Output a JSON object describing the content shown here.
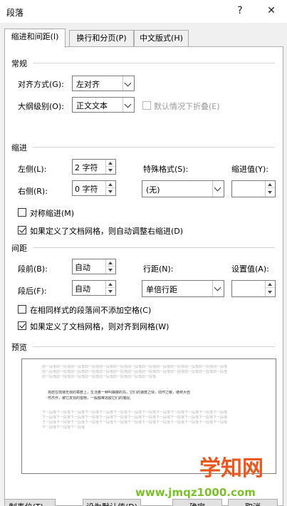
{
  "window": {
    "title": "段落",
    "help_icon": "?",
    "close_icon": "✕"
  },
  "tabs": [
    "缩进和间距(I)",
    "换行和分页(P)",
    "中文版式(H)"
  ],
  "general": {
    "heading": "常规",
    "alignment_label": "对齐方式(G):",
    "alignment_value": "左对齐",
    "outline_label": "大纲级别(O):",
    "outline_value": "正文文本",
    "collapsed_label": "默认情况下折叠(E)"
  },
  "indent": {
    "heading": "缩进",
    "left_label": "左侧(L):",
    "left_value": "2 字符",
    "right_label": "右侧(R):",
    "right_value": "0 字符",
    "special_label": "特殊格式(S):",
    "special_value": "(无)",
    "by_label": "缩进值(Y):",
    "by_value": "",
    "mirror_label": "对称缩进(M)",
    "mirror_checked": false,
    "auto_adjust_label": "如果定义了文档网格，则自动调整右缩进(D)",
    "auto_adjust_checked": true
  },
  "spacing": {
    "heading": "间距",
    "before_label": "段前(B):",
    "before_value": "自动",
    "after_label": "段后(F):",
    "after_value": "自动",
    "line_label": "行距(N):",
    "line_value": "单倍行距",
    "at_label": "设置值(A):",
    "at_value": "",
    "no_space_label": "在相同样式的段落间不添加空格(C)",
    "no_space_checked": false,
    "snap_label": "如果定义了文档网格，则对齐到网格(W)",
    "snap_checked": true
  },
  "preview": {
    "heading": "预览",
    "prev_lines": [
      "前一段落前一段落前一段落前一段落前一段落前一段落前一段落前一段落前一段落前一段落前一段落前一段落前一段落",
      "前一段落前一段落前一段落前一段落前一段落前一段落前一段落前一段落前一段落前一段落前一段落前一段落前一段落",
      "前一段落前一段落前一段落前一段落前一段落前一段落前一段落前一段落"
    ],
    "sample_lines": [
      "将居在琉璃无垠的章群上，生活着一种叫蝴蝶的鸟，它们的速度之快，动作之敏，堪称大自",
      "然杰作，被它发现的猎物，一般都难逃脱它们的捕捉。"
    ],
    "next_lines": [
      "下一段落下一段落下一段落下一段落下一段落下一段落下一段落下一段落下一段落下一段落下一段落下一段落下一段落",
      "下一段落下一段落下一段落下一段落下一段落下一段落下一段落下一段落下一段落下一段落下一段落下一段落下一段落",
      "下一段落下一段落下一段落下一段落下一段落下一段落下一段落下一段落下一段落下一段落下一段落下一段落下一段落",
      "下一段落下一段落下一段落"
    ]
  },
  "buttons": {
    "tabs": "制表位(T)...",
    "set_default": "设为默认值(D)",
    "ok": "确定",
    "cancel": "取消"
  },
  "watermark": {
    "brand": "学知网",
    "url": "www.jmqz1000.com"
  }
}
